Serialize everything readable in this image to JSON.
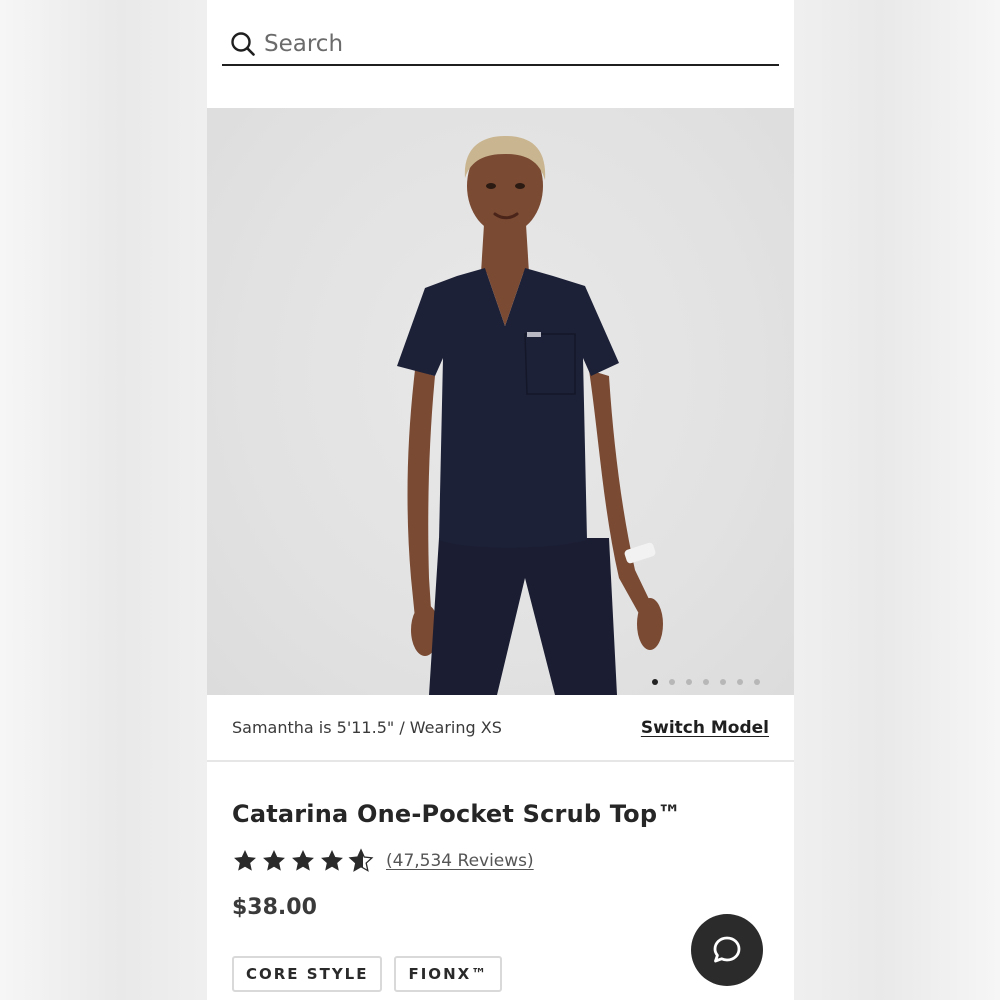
{
  "search": {
    "placeholder": "Search",
    "icon": "search-icon"
  },
  "gallery": {
    "image_description_icon": "product-photo",
    "slide_count": 7,
    "active_slide": 1
  },
  "model": {
    "info": "Samantha is 5'11.5\" / Wearing XS",
    "switch_label": "Switch Model"
  },
  "product": {
    "title": "Catarina One-Pocket Scrub Top™",
    "rating": 4.5,
    "rating_max": 5,
    "reviews_label": "(47,534 Reviews)",
    "price": "$38.00",
    "tags": [
      "CORE STYLE",
      "FIONX™"
    ]
  },
  "chat": {
    "icon": "chat-bubble-icon"
  },
  "colors": {
    "navy_scrub": "#1d2138",
    "text_dark": "#262626",
    "chat_bg": "#2b2b2b"
  }
}
